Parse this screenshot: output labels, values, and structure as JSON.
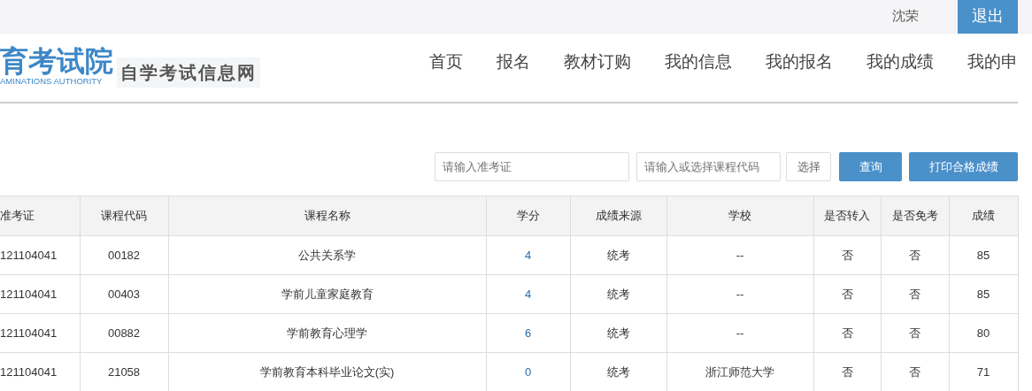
{
  "top_bar": {
    "user_name": "沈荣",
    "logout_button": "退出"
  },
  "logo": {
    "title": "育考试院",
    "subtitle": "AMINATIONS AUTHORITY",
    "site_name": "自学考试信息网"
  },
  "nav": [
    {
      "label": "首页"
    },
    {
      "label": "报名"
    },
    {
      "label": "教材订购"
    },
    {
      "label": "我的信息"
    },
    {
      "label": "我的报名"
    },
    {
      "label": "我的成绩"
    },
    {
      "label": "我的申"
    }
  ],
  "search": {
    "ticket_placeholder": "请输入准考证",
    "course_placeholder": "请输入或选择课程代码",
    "select_button": "选择",
    "query_button": "查询",
    "print_button": "打印合格成绩"
  },
  "table": {
    "columns": [
      "准考证",
      "课程代码",
      "课程名称",
      "学分",
      "成绩来源",
      "学校",
      "是否转入",
      "是否免考",
      "成绩"
    ],
    "rows": [
      [
        "121104041",
        "00182",
        "公共关系学",
        "4",
        "统考",
        "--",
        "否",
        "否",
        "85"
      ],
      [
        "121104041",
        "00403",
        "学前儿童家庭教育",
        "4",
        "统考",
        "--",
        "否",
        "否",
        "85"
      ],
      [
        "121104041",
        "00882",
        "学前教育心理学",
        "6",
        "统考",
        "--",
        "否",
        "否",
        "80"
      ],
      [
        "121104041",
        "21058",
        "学前教育本科毕业论文(实)",
        "0",
        "统考",
        "浙江师范大学",
        "否",
        "否",
        "71"
      ]
    ]
  }
}
